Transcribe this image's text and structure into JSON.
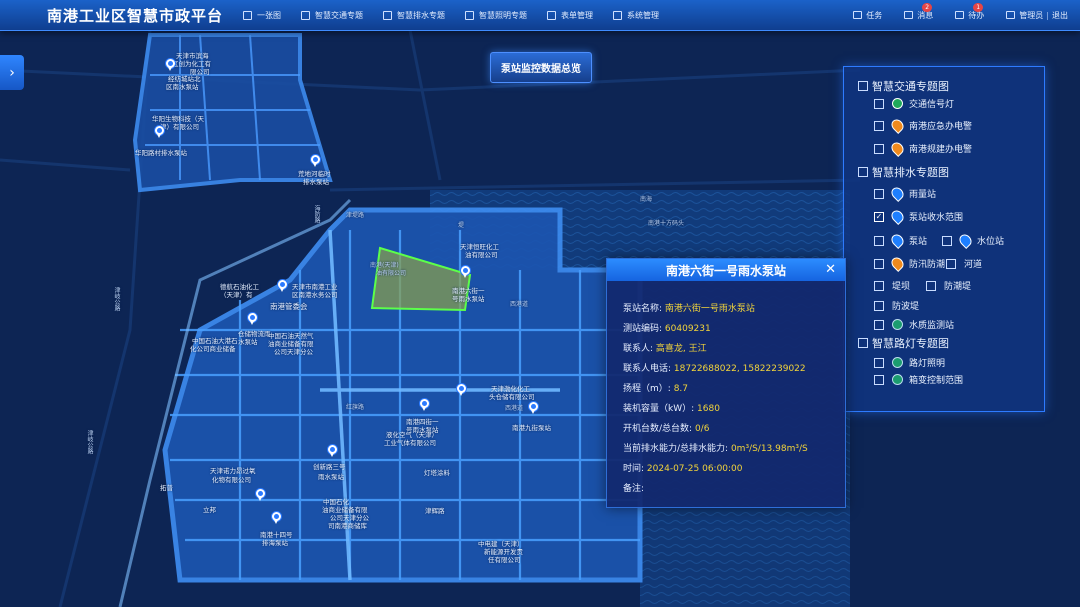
{
  "header": {
    "title": "南港工业区智慧市政平台",
    "nav": [
      "一张图",
      "智慧交通专题",
      "智慧排水专题",
      "智慧照明专题",
      "表单管理",
      "系统管理"
    ],
    "tools": {
      "task": "任务",
      "message": "消息",
      "message_badge": "2",
      "todo": "待办",
      "todo_badge": "1",
      "user": "管理员",
      "logout": "退出"
    }
  },
  "expand_icon": "›",
  "overview_button": "泵站监控数据总览",
  "layers": {
    "traffic": {
      "title": "智慧交通专题图",
      "items": [
        "交通信号灯",
        "南港应急办电警",
        "南港规建办电警"
      ]
    },
    "drainage": {
      "title": "智慧排水专题图",
      "rain_station": "雨量站",
      "pump_catchment": "泵站收水范围",
      "pump_station": "泵站",
      "water_level": "水位站",
      "flood_gate": "防汛防潮",
      "river": "河道",
      "dam": "堤坝",
      "tide_dam": "防潮堤",
      "wave_dam": "防波堤",
      "water_quality": "水质监测站"
    },
    "lighting": {
      "title": "智慧路灯专题图",
      "items": [
        "路灯照明",
        "箱变控制范围"
      ]
    },
    "checked_mark": "✓"
  },
  "popup": {
    "title": "南港六街一号雨水泵站",
    "close": "✕",
    "rows": [
      {
        "label": "泵站名称:",
        "value": "南港六街一号雨水泵站"
      },
      {
        "label": "测站编码:",
        "value": "60409231"
      },
      {
        "label": "联系人:",
        "value": "高喜龙, 王江"
      },
      {
        "label": "联系人电话:",
        "value": "18722688022, 15822239022"
      },
      {
        "label": "扬程（m）:",
        "value": "8.7"
      },
      {
        "label": "装机容量（kW）:",
        "value": "1680"
      },
      {
        "label": "开机台数/总台数:",
        "value": "0/6"
      },
      {
        "label": "当前排水能力/总排水能力:",
        "value": "0m³/S/13.98m³/S"
      },
      {
        "label": "时间:",
        "value": "2024-07-25 06:00:00"
      },
      {
        "label": "备注:",
        "value": ""
      }
    ]
  },
  "map_labels": [
    {
      "t": "天津市滨海"
    },
    {
      "t": "区创为化工有"
    },
    {
      "t": "限公司"
    },
    {
      "t": "经纺城站北"
    },
    {
      "t": "区南水泵站"
    },
    {
      "t": "华阳生物科技（天"
    },
    {
      "t": "津）有限公司"
    },
    {
      "t": "华阳路村排水泵站"
    },
    {
      "t": "荒地河临时"
    },
    {
      "t": "排水泵站"
    },
    {
      "t": "南海"
    },
    {
      "t": "南港十方码头"
    },
    {
      "t": "天津恒旺化工"
    },
    {
      "t": "油有限公司"
    },
    {
      "t": "南港六街一"
    },
    {
      "t": "号雨水泵站"
    },
    {
      "t": "南港(天津)"
    },
    {
      "t": "油有限公司"
    },
    {
      "t": "天津市南港工业"
    },
    {
      "t": "区南港水务公司"
    },
    {
      "t": "南港管委会"
    },
    {
      "t": "德航石油化工"
    },
    {
      "t": "（天津）有"
    },
    {
      "t": "仓储物流雨"
    },
    {
      "t": "水泵站"
    },
    {
      "t": "中国石油天然气"
    },
    {
      "t": "油商业储备有限"
    },
    {
      "t": "公司天津分公"
    },
    {
      "t": "中国石油大港石"
    },
    {
      "t": "化公司商业储备"
    },
    {
      "t": "天津渤化化工"
    },
    {
      "t": "头仓储有限公司"
    },
    {
      "t": "南港四街一"
    },
    {
      "t": "号雨水泵站"
    },
    {
      "t": "南港九街泵站"
    },
    {
      "t": "液化空气（天津）"
    },
    {
      "t": "工业气体有限公司"
    },
    {
      "t": "创新路三号"
    },
    {
      "t": "雨水泵站"
    },
    {
      "t": "灯塔涂料"
    },
    {
      "t": "天津诺力昂过氧"
    },
    {
      "t": "化物有限公司"
    },
    {
      "t": "中国石化"
    },
    {
      "t": "油商业储备有限"
    },
    {
      "t": "公司天津分公"
    },
    {
      "t": "司南港商储库"
    },
    {
      "t": "南港十四号"
    },
    {
      "t": "排海泵站"
    },
    {
      "t": "津辉路"
    },
    {
      "t": "中电建（天津）"
    },
    {
      "t": "新能源开发责"
    },
    {
      "t": "任有限公司"
    },
    {
      "t": "津岐公路"
    },
    {
      "t": "津岐公路"
    },
    {
      "t": "立邦"
    },
    {
      "t": "拓普"
    },
    {
      "t": "西港道"
    },
    {
      "t": "西港道"
    },
    {
      "t": "红旗路"
    },
    {
      "t": "津堤路"
    },
    {
      "t": "堤"
    },
    {
      "t": "海防路"
    }
  ]
}
